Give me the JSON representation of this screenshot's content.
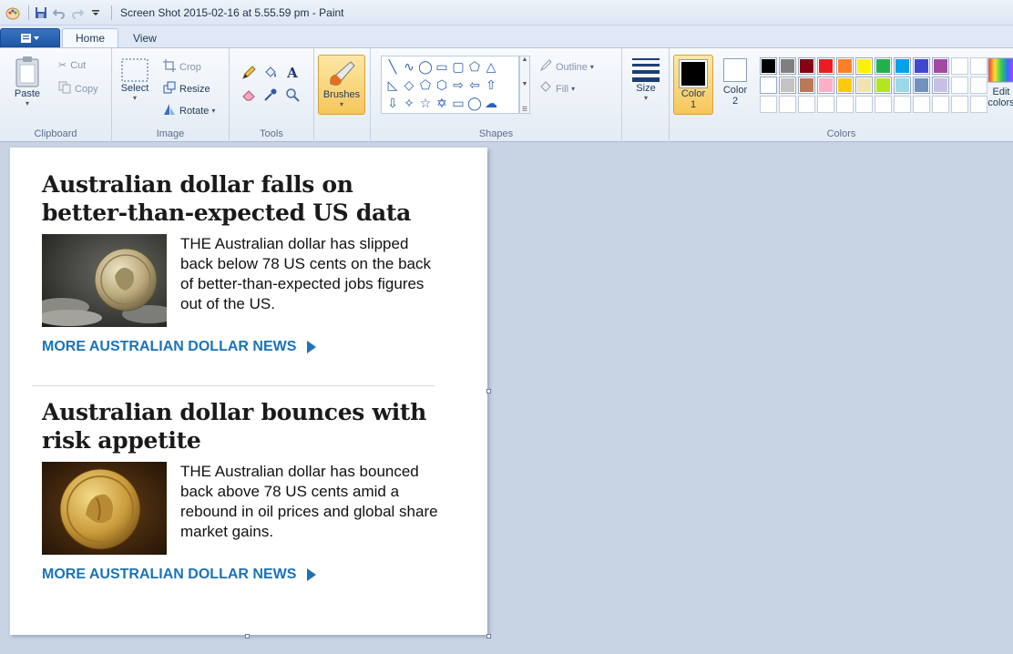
{
  "window": {
    "title": "Screen Shot 2015-02-16 at 5.55.59 pm - Paint"
  },
  "tabs": [
    {
      "label": "Home",
      "active": true
    },
    {
      "label": "View",
      "active": false
    }
  ],
  "ribbon": {
    "clipboard": {
      "label": "Clipboard",
      "paste": "Paste",
      "cut": "Cut",
      "copy": "Copy"
    },
    "image": {
      "label": "Image",
      "select": "Select",
      "crop": "Crop",
      "resize": "Resize",
      "rotate": "Rotate"
    },
    "tools": {
      "label": "Tools"
    },
    "brushes": {
      "label": "Brushes"
    },
    "shapes": {
      "label": "Shapes",
      "outline": "Outline",
      "fill": "Fill"
    },
    "size": {
      "label": "Size"
    },
    "colors": {
      "label": "Colors",
      "color1": "Color",
      "color1_num": "1",
      "color2": "Color",
      "color2_num": "2",
      "edit_colors_line1": "Edit",
      "edit_colors_line2": "colors",
      "color1_value": "#000000",
      "color2_value": "#ffffff",
      "palette": [
        "#000000",
        "#7f7f7f",
        "#880015",
        "#ed1c24",
        "#ff7f27",
        "#fff200",
        "#22b14c",
        "#00a2e8",
        "#3f48cc",
        "#a349a4",
        "",
        "",
        "#ffffff",
        "#c3c3c3",
        "#b97a57",
        "#ffaec9",
        "#ffc90e",
        "#efe4b0",
        "#b5e61d",
        "#99d9ea",
        "#7092be",
        "#c8bfe7",
        "",
        "",
        "",
        "",
        "",
        "",
        "",
        "",
        "",
        "",
        "",
        "",
        "",
        ""
      ]
    }
  },
  "articles": [
    {
      "headline": "Australian dollar falls on better-than-expected US data",
      "summary": "THE Australian dollar has slipped back below 78 US cents on the back of better-than-expected jobs figures out of the US.",
      "more_link": "MORE AUSTRALIAN DOLLAR NEWS"
    },
    {
      "headline": "Australian dollar bounces with risk appetite",
      "summary": "THE Australian dollar has bounced back above 78 US cents amid a rebound in oil prices and global share market gains.",
      "more_link": "MORE AUSTRALIAN DOLLAR NEWS"
    }
  ]
}
